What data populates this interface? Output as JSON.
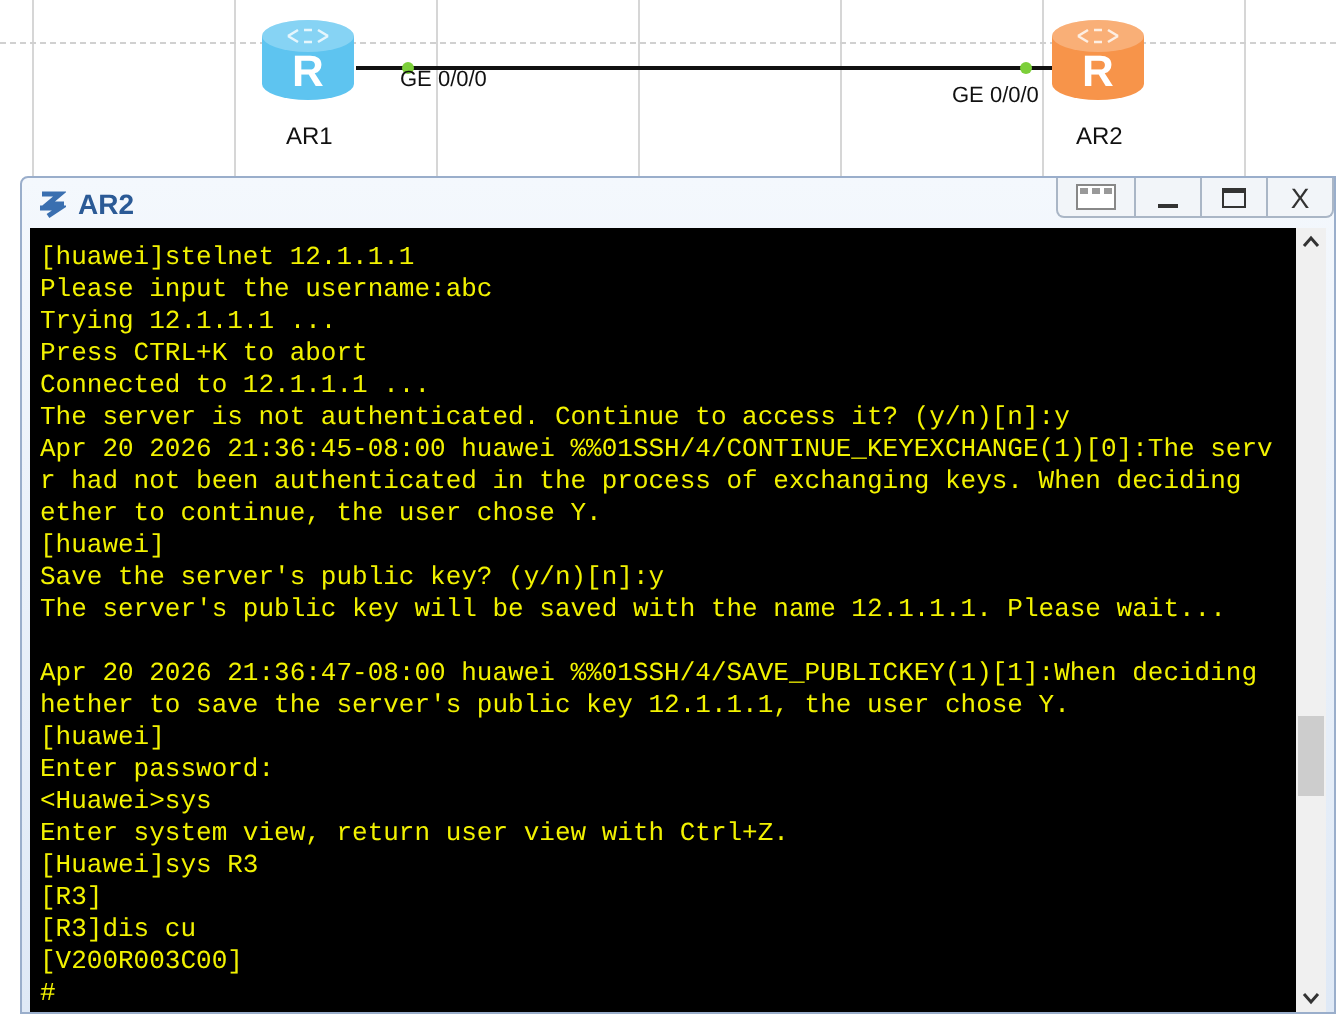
{
  "topology": {
    "devices": [
      {
        "name": "AR1",
        "color": "#5ec4f0",
        "icon_letter": "R",
        "port": "GE 0/0/0"
      },
      {
        "name": "AR2",
        "color": "#f7944a",
        "icon_letter": "R",
        "port": "GE 0/0/0"
      }
    ]
  },
  "window": {
    "title": "AR2",
    "close_label": "X"
  },
  "terminal": {
    "lines": [
      {
        "kind": "text",
        "text": "[huawei]stelnet 12.1.1.1"
      },
      {
        "kind": "text",
        "text": "Please input the username:abc"
      },
      {
        "kind": "text",
        "text": "Trying 12.1.1.1 ..."
      },
      {
        "kind": "text",
        "text": "Press CTRL+K to abort"
      },
      {
        "kind": "text",
        "text": "Connected to 12.1.1.1 ..."
      },
      {
        "kind": "text",
        "text": "The server is not authenticated. Continue to access it? (y/n)[n]:y"
      },
      {
        "kind": "text",
        "text": "Apr 20 2026 21:36:45-08:00 huawei %%01SSH/4/CONTINUE_KEYEXCHANGE(1)[0]:The serv"
      },
      {
        "kind": "text",
        "text": "r had not been authenticated in the process of exchanging keys. When deciding"
      },
      {
        "kind": "text",
        "text": "ether to continue, the user chose Y."
      },
      {
        "kind": "text",
        "text": "[huawei]"
      },
      {
        "kind": "text",
        "text": "Save the server's public key? (y/n)[n]:y"
      },
      {
        "kind": "text",
        "text": "The server's public key will be saved with the name 12.1.1.1. Please wait..."
      },
      {
        "kind": "blank"
      },
      {
        "kind": "text",
        "text": "Apr 20 2026 21:36:47-08:00 huawei %%01SSH/4/SAVE_PUBLICKEY(1)[1]:When deciding"
      },
      {
        "kind": "text",
        "text": "hether to save the server's public key 12.1.1.1, the user chose Y."
      },
      {
        "kind": "text",
        "text": "[huawei]"
      },
      {
        "kind": "text",
        "text": "Enter password:"
      },
      {
        "kind": "text",
        "text": "<Huawei>sys"
      },
      {
        "kind": "text",
        "text": "Enter system view, return user view with Ctrl+Z."
      },
      {
        "kind": "text",
        "text": "[Huawei]sys R3"
      },
      {
        "kind": "text",
        "text": "[R3]"
      },
      {
        "kind": "text",
        "text": "[R3]dis cu"
      },
      {
        "kind": "text",
        "text": "[V200R003C00]"
      },
      {
        "kind": "text",
        "text": "#"
      }
    ]
  }
}
